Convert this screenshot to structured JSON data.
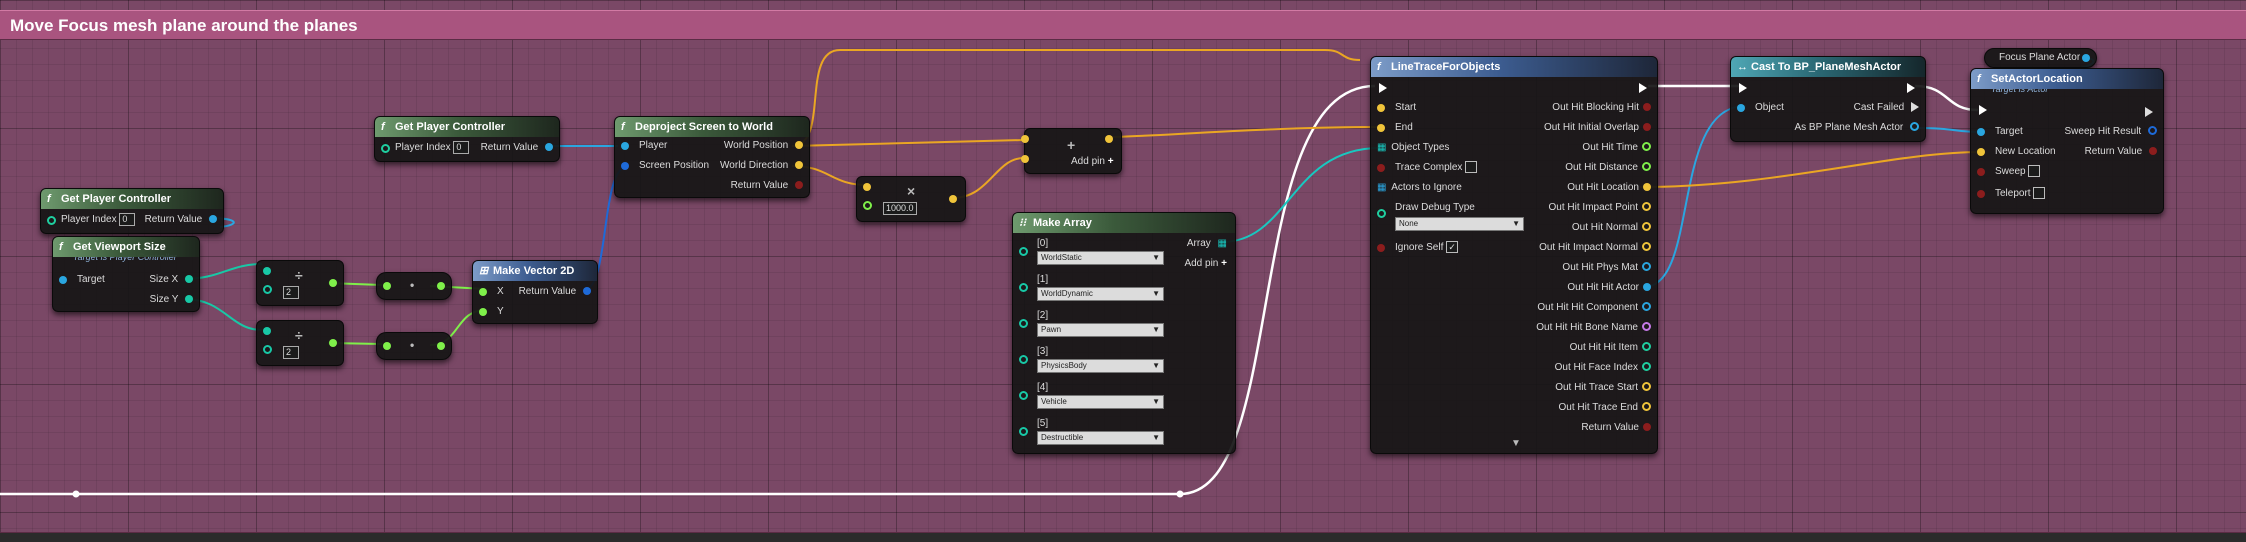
{
  "comment": {
    "title": "Move Focus mesh plane around the planes"
  },
  "colors": {
    "exec": "#ffffff",
    "float": "#eaa623",
    "vector": "#f0c43a",
    "object": "#2aa6e0",
    "bool": "#8c1d1d",
    "int": "#1fcfa0",
    "struct": "#1e6ad8",
    "array": "#18c8c0",
    "background": "#7a4866",
    "comment": "#a9547f"
  },
  "nodes": {
    "get_pc_1": {
      "title": "Get Player Controller",
      "pin_in": "Player Index",
      "pin_in_value": "0",
      "pin_out": "Return Value"
    },
    "get_viewport_size": {
      "title": "Get Viewport Size",
      "subtitle": "Target is Player Controller",
      "target": "Target",
      "size_x": "Size X",
      "size_y": "Size Y"
    },
    "divide_1": {
      "value": "2",
      "op": "÷"
    },
    "divide_2": {
      "value": "2",
      "op": "÷"
    },
    "conv_1": {
      "op": "•"
    },
    "conv_2": {
      "op": "•"
    },
    "get_pc_2": {
      "title": "Get Player Controller",
      "pin_in": "Player Index",
      "pin_in_value": "0",
      "pin_out": "Return Value"
    },
    "make_vector_2d": {
      "title": "Make Vector 2D",
      "x": "X",
      "y": "Y",
      "out": "Return Value"
    },
    "deproject": {
      "title": "Deproject Screen to World",
      "player": "Player",
      "screen_pos": "Screen Position",
      "world_pos": "World Position",
      "world_dir": "World Direction",
      "ret": "Return Value"
    },
    "multiply": {
      "value": "1000.0",
      "op": "×"
    },
    "add": {
      "op": "+",
      "add_pin": "Add pin"
    },
    "make_array": {
      "title": "Make Array",
      "array": "Array",
      "add_pin": "Add pin",
      "items": [
        {
          "index": "[0]",
          "value": "WorldStatic"
        },
        {
          "index": "[1]",
          "value": "WorldDynamic"
        },
        {
          "index": "[2]",
          "value": "Pawn"
        },
        {
          "index": "[3]",
          "value": "PhysicsBody"
        },
        {
          "index": "[4]",
          "value": "Vehicle"
        },
        {
          "index": "[5]",
          "value": "Destructible"
        }
      ]
    },
    "line_trace": {
      "title": "LineTraceForObjects",
      "inputs": [
        "Start",
        "End",
        "Object Types",
        "Trace Complex",
        "Actors to Ignore",
        "Draw Debug Type",
        "Ignore Self"
      ],
      "draw_debug_value": "None",
      "outputs": [
        "Out Hit Blocking Hit",
        "Out Hit Initial Overlap",
        "Out Hit Time",
        "Out Hit Distance",
        "Out Hit Location",
        "Out Hit Impact Point",
        "Out Hit Normal",
        "Out Hit Impact Normal",
        "Out Hit Phys Mat",
        "Out Hit Hit Actor",
        "Out Hit Hit Component",
        "Out Hit Hit Bone Name",
        "Out Hit Hit Item",
        "Out Hit Face Index",
        "Out Hit Trace Start",
        "Out Hit Trace End",
        "Return Value"
      ],
      "expand": "▼"
    },
    "cast": {
      "title": "Cast To BP_PlaneMeshActor",
      "object": "Object",
      "failed": "Cast Failed",
      "as": "As BP Plane Mesh Actor"
    },
    "focus_var": {
      "title": "Focus Plane Actor"
    },
    "set_location": {
      "title": "SetActorLocation",
      "subtitle": "Target is Actor",
      "target": "Target",
      "new_loc": "New Location",
      "sweep": "Sweep",
      "teleport": "Teleport",
      "sweep_hit": "Sweep Hit Result",
      "ret": "Return Value"
    }
  }
}
